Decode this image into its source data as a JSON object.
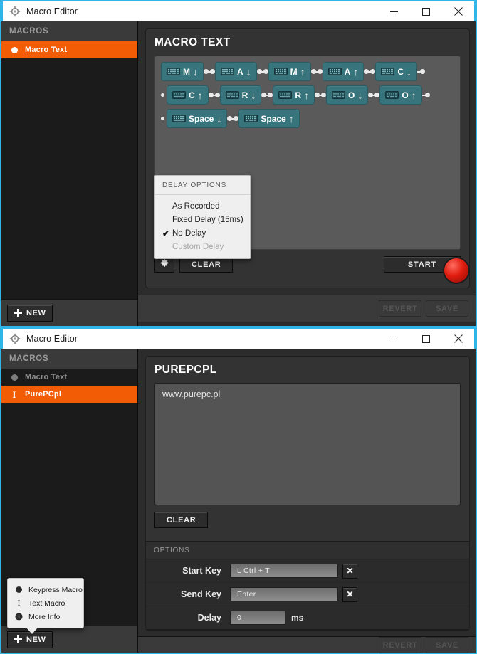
{
  "window1": {
    "title": "Macro Editor",
    "app_icon": "gear-app-icon",
    "controls": {
      "minimize": "minimize-icon",
      "maximize": "maximize-icon",
      "close": "close-icon"
    },
    "sidebar": {
      "header": "MACROS",
      "items": [
        {
          "label": "Macro Text",
          "icon": "keypress-dot-icon",
          "active": true
        }
      ],
      "new_button": "NEW"
    },
    "panel_title": "MACRO TEXT",
    "keys": [
      [
        {
          "label": "M",
          "dir": "down"
        },
        {
          "label": "A",
          "dir": "down"
        },
        {
          "label": "M",
          "dir": "up"
        },
        {
          "label": "A",
          "dir": "up"
        },
        {
          "label": "C",
          "dir": "down"
        }
      ],
      [
        {
          "label": "C",
          "dir": "up"
        },
        {
          "label": "R",
          "dir": "down"
        },
        {
          "label": "R",
          "dir": "up"
        },
        {
          "label": "O",
          "dir": "down"
        },
        {
          "label": "O",
          "dir": "up"
        }
      ],
      [
        {
          "label": "Space",
          "dir": "down"
        },
        {
          "label": "Space",
          "dir": "up"
        }
      ]
    ],
    "toolbar": {
      "settings_icon": "gear-icon",
      "clear_label": "CLEAR",
      "start_label": "START",
      "record_button": "record-button"
    },
    "delay_popup": {
      "title": "DELAY OPTIONS",
      "options": [
        {
          "label": "As Recorded",
          "checked": false,
          "disabled": false
        },
        {
          "label": "Fixed Delay (15ms)",
          "checked": false,
          "disabled": false
        },
        {
          "label": "No Delay",
          "checked": true,
          "disabled": false
        },
        {
          "label": "Custom Delay",
          "checked": false,
          "disabled": true
        }
      ],
      "check_glyph": "✔"
    },
    "actions": {
      "revert": "REVERT",
      "save": "SAVE"
    }
  },
  "window2": {
    "title": "Macro Editor",
    "app_icon": "gear-app-icon",
    "controls": {
      "minimize": "minimize-icon",
      "maximize": "maximize-icon",
      "close": "close-icon"
    },
    "sidebar": {
      "header": "MACROS",
      "items": [
        {
          "label": "Macro Text",
          "icon": "keypress-dot-icon",
          "active": false
        },
        {
          "label": "PurePCpl",
          "icon": "text-ibeam-icon",
          "active": true
        }
      ],
      "new_button": "NEW"
    },
    "panel_title": "PUREPCPL",
    "text_value": "www.purepc.pl",
    "clear_label": "CLEAR",
    "options": {
      "title": "OPTIONS",
      "rows": [
        {
          "label": "Start Key",
          "value": "L Ctrl + T",
          "clear_icon": "x-icon",
          "unit": ""
        },
        {
          "label": "Send Key",
          "value": "Enter",
          "clear_icon": "x-icon",
          "unit": ""
        },
        {
          "label": "Delay",
          "value": "0",
          "clear_icon": "",
          "unit": "ms"
        }
      ]
    },
    "actions": {
      "revert": "REVERT",
      "save": "SAVE"
    },
    "new_popup": {
      "items": [
        {
          "label": "Keypress Macro",
          "icon": "keypress-dot-icon"
        },
        {
          "label": "Text Macro",
          "icon": "text-ibeam-icon"
        },
        {
          "label": "More Info",
          "icon": "info-icon"
        }
      ]
    }
  },
  "glyphs": {
    "arrow_down": "↓",
    "arrow_up": "↑",
    "x": "✕"
  },
  "colors": {
    "accent_border": "#2fb5e8",
    "selection": "#f25c05",
    "key_chip": "#37747c",
    "record": "#e01d10"
  }
}
